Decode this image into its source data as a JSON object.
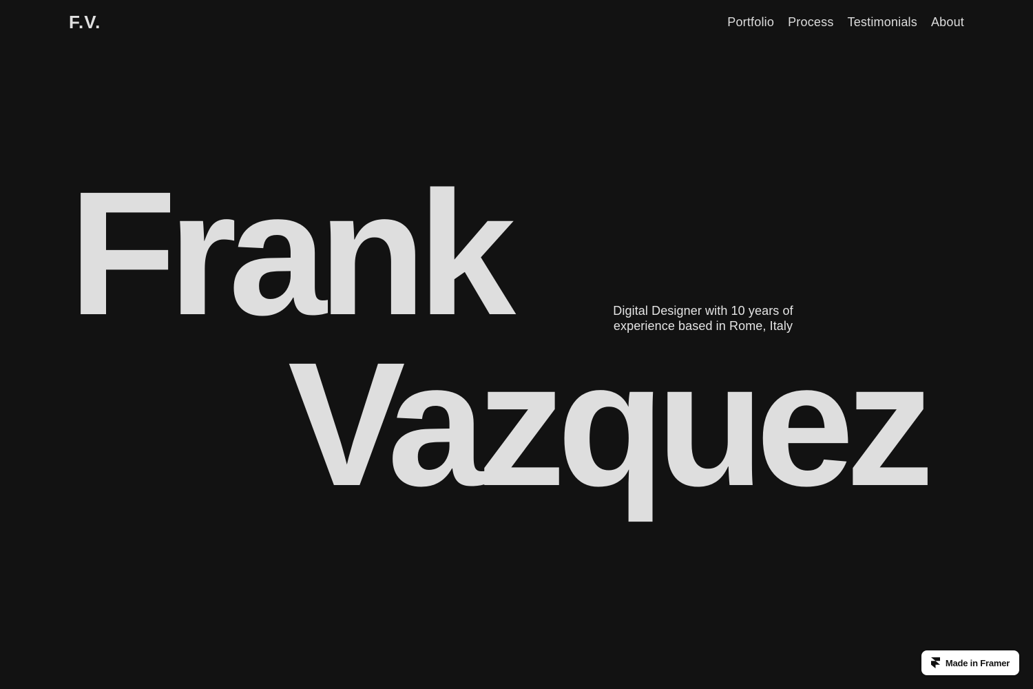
{
  "header": {
    "logo": "F.V.",
    "nav": [
      {
        "label": "Portfolio"
      },
      {
        "label": "Process"
      },
      {
        "label": "Testimonials"
      },
      {
        "label": "About"
      }
    ]
  },
  "hero": {
    "first_name": "Frank",
    "last_name": "Vazquez",
    "tagline": "Digital Designer with 10 years of experience based in Rome, Italy"
  },
  "badge": {
    "label": "Made in Framer",
    "icon": "framer-logo-icon"
  },
  "colors": {
    "background": "#121212",
    "text": "#dedede",
    "badge_background": "#ffffff",
    "badge_text": "#111111"
  }
}
